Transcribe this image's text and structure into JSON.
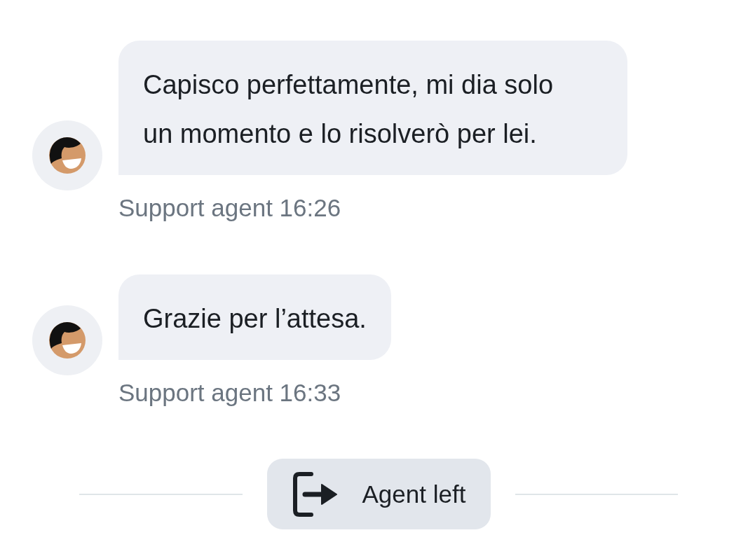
{
  "messages": [
    {
      "text": "Capisco perfettamente, mi dia solo un momento e lo risolverò per lei.",
      "meta": "Support agent 16:26"
    },
    {
      "text": "Grazie per l’attesa.",
      "meta": "Support agent 16:33"
    }
  ],
  "event": {
    "label": "Agent left"
  }
}
